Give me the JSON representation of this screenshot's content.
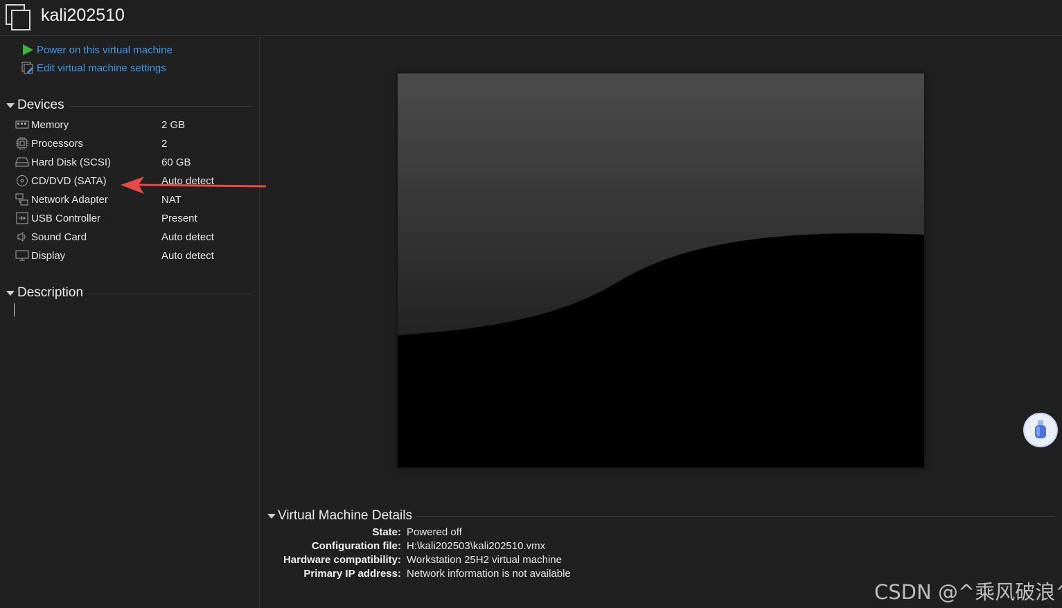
{
  "window": {
    "title": "kali202510",
    "icon": "vm-tab-icon"
  },
  "actions": [
    {
      "label": "Power on this virtual machine",
      "icon": "play-icon"
    },
    {
      "label": "Edit virtual machine settings",
      "icon": "edit-settings-icon"
    }
  ],
  "devices": {
    "header": "Devices",
    "items": [
      {
        "name": "Memory",
        "value": "2 GB",
        "icon": "memory-icon"
      },
      {
        "name": "Processors",
        "value": "2",
        "icon": "processor-icon"
      },
      {
        "name": "Hard Disk (SCSI)",
        "value": "60 GB",
        "icon": "hard-disk-icon"
      },
      {
        "name": "CD/DVD (SATA)",
        "value": "Auto detect",
        "icon": "cd-dvd-icon"
      },
      {
        "name": "Network Adapter",
        "value": "NAT",
        "icon": "network-adapter-icon"
      },
      {
        "name": "USB Controller",
        "value": "Present",
        "icon": "usb-controller-icon"
      },
      {
        "name": "Sound Card",
        "value": "Auto detect",
        "icon": "sound-card-icon"
      },
      {
        "name": "Display",
        "value": "Auto detect",
        "icon": "display-icon"
      }
    ]
  },
  "description": {
    "header": "Description",
    "value": ""
  },
  "details": {
    "header": "Virtual Machine Details",
    "rows": [
      {
        "label": "State:",
        "value": "Powered off"
      },
      {
        "label": "Configuration file:",
        "value": "H:\\kali202503\\kali202510.vmx"
      },
      {
        "label": "Hardware compatibility:",
        "value": "Workstation 25H2 virtual machine"
      },
      {
        "label": "Primary IP address:",
        "value": "Network information is not available"
      }
    ]
  },
  "watermark": "CSDN @^乘风破浪^",
  "colors": {
    "background": "#202020",
    "link": "#3d9be9",
    "play": "#3db33d",
    "annotation_arrow": "#e84a4a"
  }
}
